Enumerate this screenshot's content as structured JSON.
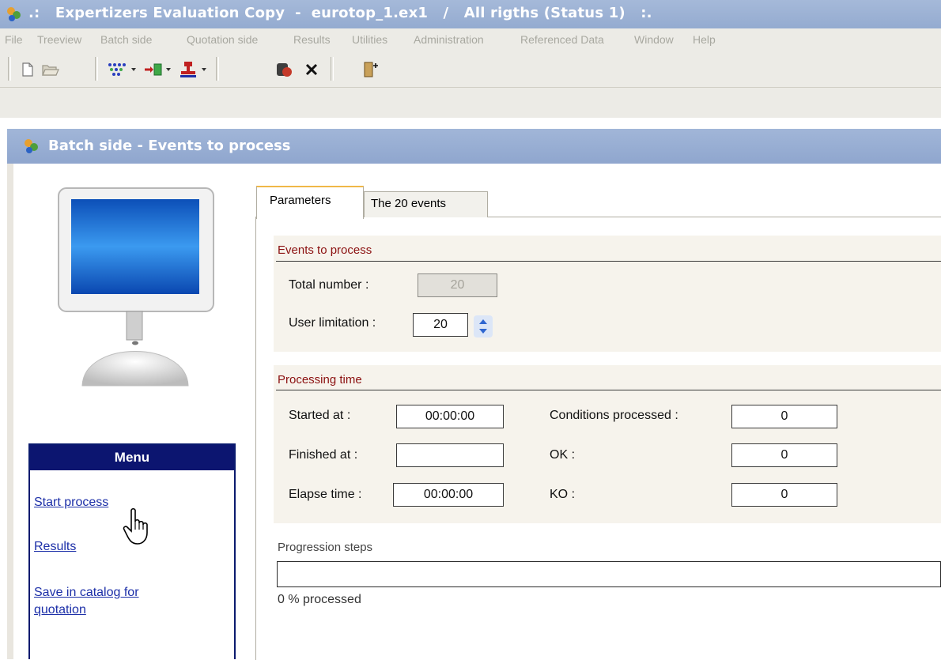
{
  "app": {
    "title": ".:   Expertizers Evaluation Copy  -  eurotop_1.ex1   /   All rigths (Status 1)   :."
  },
  "menubar": [
    "File",
    "Treeview",
    "Batch side",
    "Quotation side",
    "Results",
    "Utilities",
    "Administration",
    "Referenced Data",
    "Window",
    "Help"
  ],
  "window": {
    "title": "Batch side - Events to process"
  },
  "tabs": {
    "parameters": "Parameters",
    "events": "The 20 events"
  },
  "events_group": {
    "title": "Events to process",
    "total_label": "Total number :",
    "total_value": "20",
    "limit_label": "User limitation :",
    "limit_value": "20"
  },
  "time_group": {
    "title": "Processing time",
    "started_label": "Started at :",
    "started_value": "00:00:00",
    "finished_label": "Finished at :",
    "finished_value": "",
    "elapse_label": "Elapse time :",
    "elapse_value": "00:00:00",
    "conditions_label": "Conditions processed :",
    "conditions_value": "0",
    "ok_label": "OK :",
    "ok_value": "0",
    "ko_label": "KO :",
    "ko_value": "0"
  },
  "progress": {
    "title": "Progression steps",
    "fraction": 0,
    "status": "0 % processed"
  },
  "menu": {
    "header": "Menu",
    "start": "Start process",
    "results": "Results",
    "save_line1": "Save in catalog for",
    "save_line2": "quotation"
  },
  "colors": {
    "title_bar": "#94abd0",
    "menu_header": "#0c1570",
    "group_title": "#8b1010",
    "link": "#1c2fa8"
  }
}
